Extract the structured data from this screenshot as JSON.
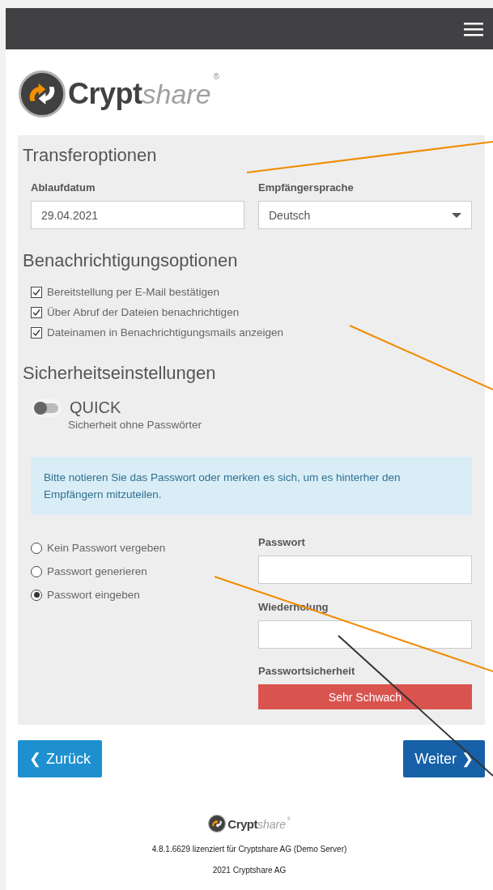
{
  "logo": {
    "bold": "Crypt",
    "light": "share",
    "mark": "®"
  },
  "transfer": {
    "title": "Transferoptionen",
    "expiry": {
      "label": "Ablaufdatum",
      "value": "29.04.2021"
    },
    "language": {
      "label": "Empfängersprache",
      "value": "Deutsch"
    }
  },
  "notifications": {
    "title": "Benachrichtigungsoptionen",
    "options": [
      {
        "label": "Bereitstellung per E-Mail bestätigen",
        "checked": true
      },
      {
        "label": "Über Abruf der Dateien benachrichtigen",
        "checked": true
      },
      {
        "label": "Dateinamen in Benachrichtigungsmails anzeigen",
        "checked": true
      }
    ]
  },
  "security": {
    "title": "Sicherheitseinstellungen",
    "quick": {
      "label": "QUICK",
      "description": "Sicherheit ohne Passwörter",
      "on": false
    },
    "info": "Bitte notieren Sie das Passwort oder merken es sich, um es hinterher den Empfängern mitzuteilen.",
    "modes": [
      {
        "label": "Kein Passwort vergeben",
        "selected": false
      },
      {
        "label": "Passwort generieren",
        "selected": false
      },
      {
        "label": "Passwort eingeben",
        "selected": true
      }
    ],
    "password": {
      "label": "Passwort"
    },
    "repeat": {
      "label": "Wiederholung"
    },
    "strength": {
      "label": "Passwortsicherheit",
      "reading": "Sehr Schwach",
      "level": 1
    }
  },
  "buttons": {
    "back": {
      "icon": "❮",
      "label": "Zurück"
    },
    "next": {
      "label": "Weiter",
      "icon": "❯"
    }
  },
  "footer": {
    "logo": {
      "bold": "Crypt",
      "light": "share",
      "mark": "®"
    },
    "version": "4.8.1.6629 lizenziert für Cryptshare AG (Demo Server)",
    "copyright": "2021 Cryptshare AG"
  }
}
